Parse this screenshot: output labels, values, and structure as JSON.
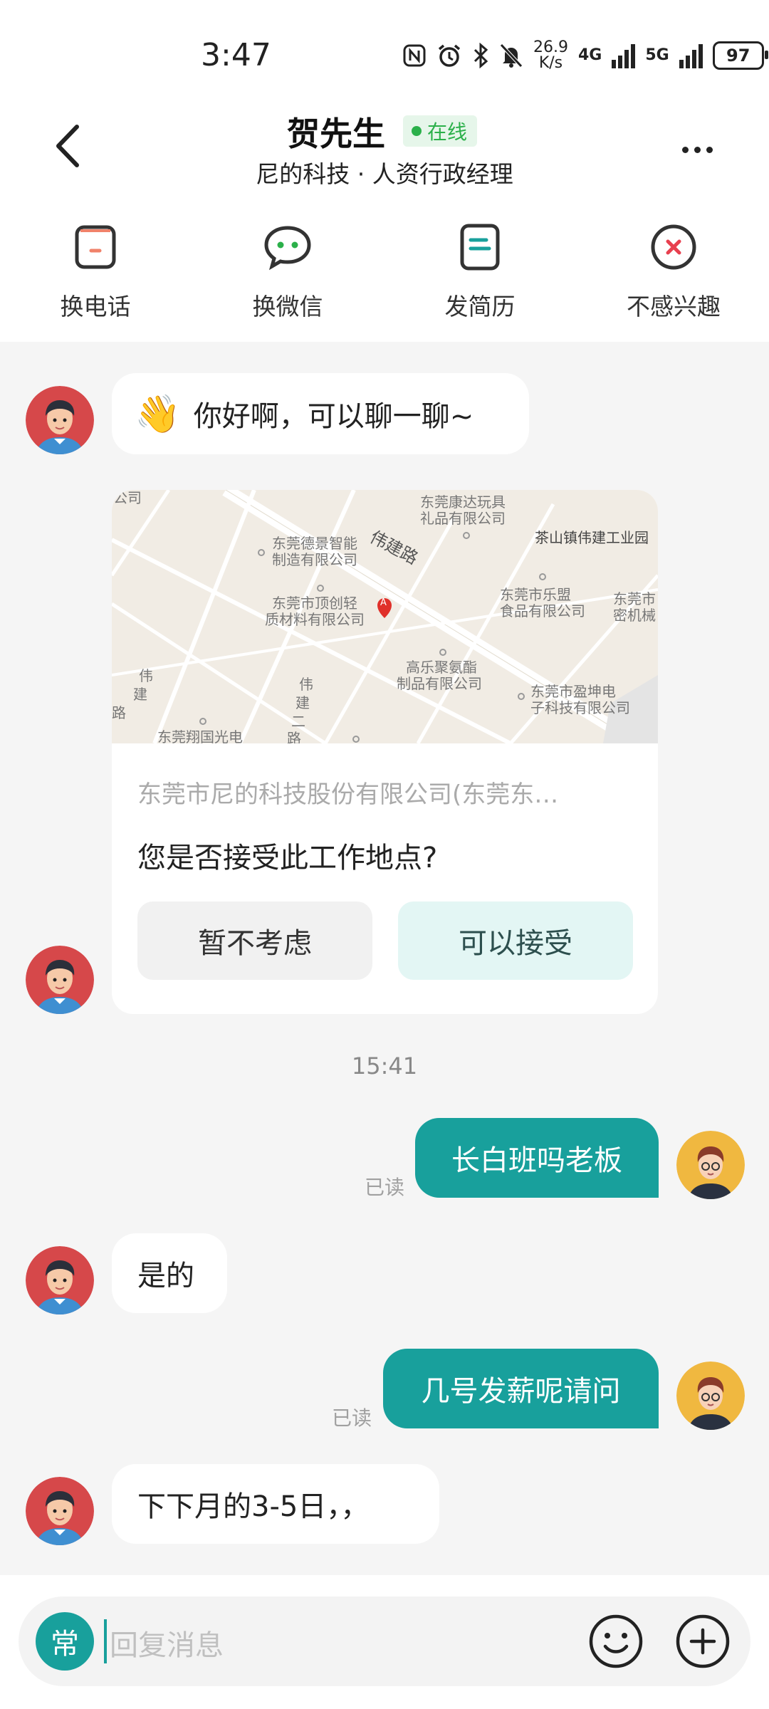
{
  "status_bar": {
    "time": "3:47",
    "net_speed_value": "26.9",
    "net_speed_unit": "K/s",
    "net1": "4G",
    "net2": "5G",
    "battery": "97"
  },
  "header": {
    "name": "贺先生",
    "online_label": "在线",
    "company": "尼的科技 · 人资行政经理"
  },
  "actions": [
    {
      "label": "换电话",
      "icon": "phone-icon"
    },
    {
      "label": "换微信",
      "icon": "wechat-icon"
    },
    {
      "label": "发简历",
      "icon": "resume-icon"
    },
    {
      "label": "不感兴趣",
      "icon": "not-interested-icon"
    }
  ],
  "messages": {
    "greeting_emoji": "👋",
    "greeting": "你好啊，可以聊一聊~",
    "location_card": {
      "address": "东莞市尼的科技股份有限公司(东莞东…",
      "question": "您是否接受此工作地点?",
      "decline": "暂不考虑",
      "accept": "可以接受",
      "map_labels": [
        "公司",
        "东莞康达玩具",
        "礼品有限公司",
        "茶山镇伟建工业园",
        "东莞德景智能",
        "制造有限公司",
        "伟建路",
        "东莞市乐盟",
        "食品有限公司",
        "东莞市",
        "密机械",
        "东莞市顶创轻",
        "质材料有限公司",
        "高乐聚氨酯",
        "制品有限公司",
        "东莞市盈坤电",
        "子科技有限公司",
        "伟",
        "建",
        "路",
        "伟",
        "建",
        "二",
        "路",
        "东莞翔国光电"
      ],
      "map_pin": "A"
    },
    "timestamp": "15:41",
    "out1": "长白班吗老板",
    "read1": "已读",
    "in2": "是的",
    "out2": "几号发薪呢请问",
    "read2": "已读",
    "in3": "下下月的3-5日，，"
  },
  "input": {
    "quick_label": "常",
    "placeholder": "回复消息"
  },
  "colors": {
    "accent": "#18a09c",
    "online": "#2bb04a",
    "background": "#f5f5f5"
  }
}
